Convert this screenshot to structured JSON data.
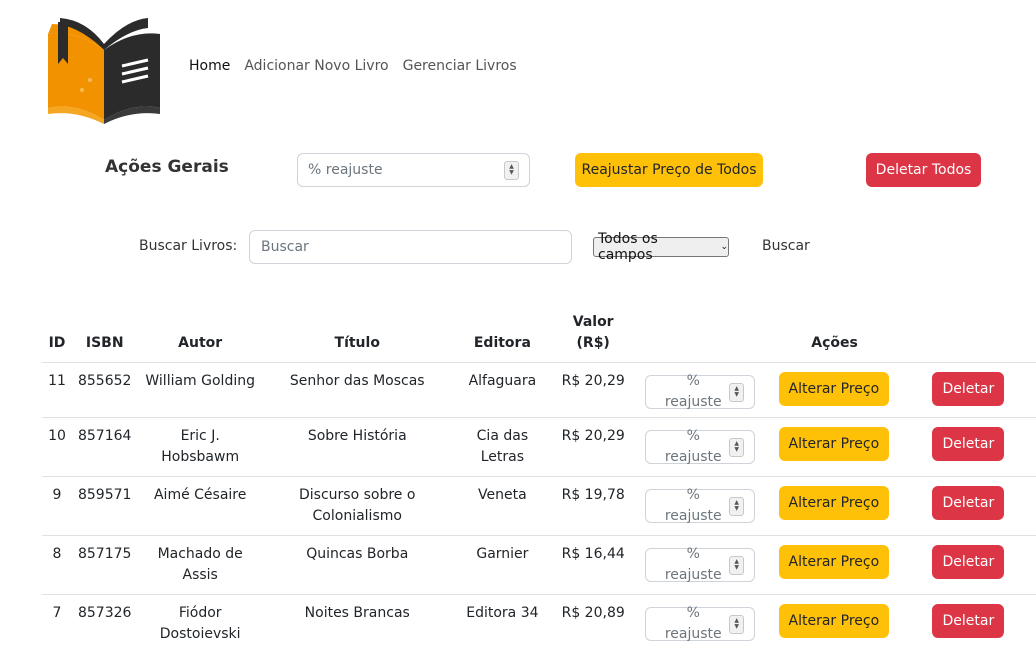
{
  "nav": {
    "items": [
      "Home",
      "Adicionar Novo Livro",
      "Gerenciar Livros"
    ]
  },
  "general": {
    "title": "Ações Gerais",
    "reajuste_placeholder": "% reajuste",
    "reajustar_label": "Reajustar Preço de Todos",
    "deletar_todos_label": "Deletar Todos"
  },
  "search": {
    "label": "Buscar Livros:",
    "placeholder": "Buscar",
    "field_selected": "Todos os campos",
    "button_label": "Buscar"
  },
  "table": {
    "headers": {
      "id": "ID",
      "isbn": "ISBN",
      "autor": "Autor",
      "titulo": "Título",
      "editora": "Editora",
      "valor": "Valor (R$)",
      "acoes": "Ações"
    },
    "rows": [
      {
        "id": "11",
        "isbn": "855652",
        "autor": "William Golding",
        "titulo": "Senhor das Moscas",
        "editora": "Alfaguara",
        "valor": "R$ 20,29"
      },
      {
        "id": "10",
        "isbn": "857164",
        "autor": "Eric J. Hobsbawm",
        "titulo": "Sobre História",
        "editora": "Cia das Letras",
        "valor": "R$ 20,29"
      },
      {
        "id": "9",
        "isbn": "859571",
        "autor": "Aimé Césaire",
        "titulo": "Discurso sobre o Colonialismo",
        "editora": "Veneta",
        "valor": "R$ 19,78"
      },
      {
        "id": "8",
        "isbn": "857175",
        "autor": "Machado de Assis",
        "titulo": "Quincas Borba",
        "editora": "Garnier",
        "valor": "R$ 16,44"
      },
      {
        "id": "7",
        "isbn": "857326",
        "autor": "Fiódor Dostoievski",
        "titulo": "Noites Brancas",
        "editora": "Editora 34",
        "valor": "R$ 20,89"
      }
    ],
    "row_input_placeholder": "% reajuste",
    "alterar_label": "Alterar Preço",
    "deletar_label": "Deletar"
  },
  "colors": {
    "warning": "#ffc107",
    "danger": "#dc3545",
    "logo_orange": "#f39200",
    "logo_dark": "#2b2b2b"
  }
}
